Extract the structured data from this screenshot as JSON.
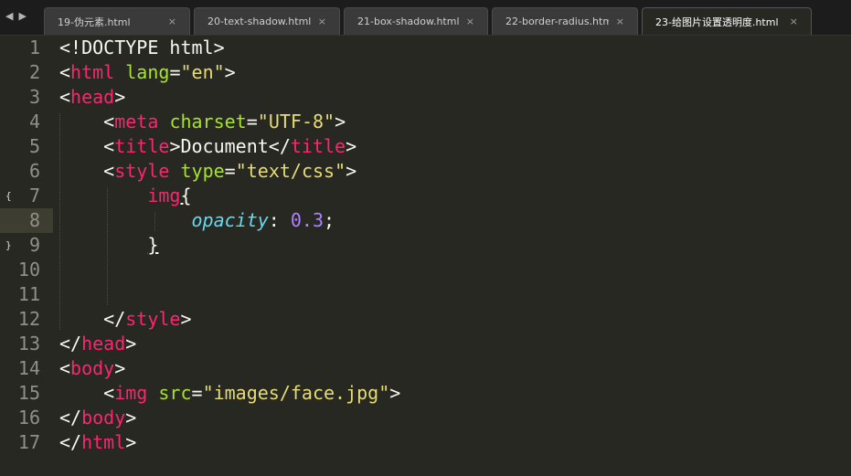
{
  "nav": {
    "back_icon": "left-triangle-icon",
    "forward_icon": "right-triangle-icon"
  },
  "tabs": [
    {
      "label": "19-伪元素.html",
      "close": "×"
    },
    {
      "label": "20-text-shadow.html",
      "close": "×"
    },
    {
      "label": "21-box-shadow.html",
      "close": "×"
    },
    {
      "label": "22-border-radius.html",
      "close": "×"
    },
    {
      "label": "23-给图片设置透明度.html",
      "close": "×"
    }
  ],
  "editor": {
    "current_line": 8,
    "fold_markers": {
      "7": "{",
      "9": "}"
    },
    "lines": [
      {
        "n": "1",
        "indent": "",
        "tokens": [
          [
            "plain",
            "<!DOCTYPE html>"
          ]
        ]
      },
      {
        "n": "2",
        "indent": "",
        "tokens": [
          [
            "plain",
            "<"
          ],
          [
            "tag",
            "html"
          ],
          [
            "plain",
            " "
          ],
          [
            "attr",
            "lang"
          ],
          [
            "plain",
            "="
          ],
          [
            "str",
            "\"en\""
          ],
          [
            "plain",
            ">"
          ]
        ]
      },
      {
        "n": "3",
        "indent": "",
        "tokens": [
          [
            "plain",
            "<"
          ],
          [
            "tag",
            "head"
          ],
          [
            "plain",
            ">"
          ]
        ]
      },
      {
        "n": "4",
        "indent": "    ",
        "tokens": [
          [
            "plain",
            "<"
          ],
          [
            "tag",
            "meta"
          ],
          [
            "plain",
            " "
          ],
          [
            "attr",
            "charset"
          ],
          [
            "plain",
            "="
          ],
          [
            "str",
            "\"UTF-8\""
          ],
          [
            "plain",
            ">"
          ]
        ]
      },
      {
        "n": "5",
        "indent": "    ",
        "tokens": [
          [
            "plain",
            "<"
          ],
          [
            "tag",
            "title"
          ],
          [
            "plain",
            ">Document</"
          ],
          [
            "tag",
            "title"
          ],
          [
            "plain",
            ">"
          ]
        ]
      },
      {
        "n": "6",
        "indent": "    ",
        "tokens": [
          [
            "plain",
            "<"
          ],
          [
            "tag",
            "style"
          ],
          [
            "plain",
            " "
          ],
          [
            "attr",
            "type"
          ],
          [
            "plain",
            "="
          ],
          [
            "str",
            "\"text/css\""
          ],
          [
            "plain",
            ">"
          ]
        ]
      },
      {
        "n": "7",
        "indent": "        ",
        "tokens": [
          [
            "tag",
            "img"
          ],
          [
            "plain-ul",
            "{"
          ]
        ]
      },
      {
        "n": "8",
        "indent": "            ",
        "tokens": [
          [
            "prop",
            "opacity"
          ],
          [
            "plain",
            ": "
          ],
          [
            "num",
            "0.3"
          ],
          [
            "plain",
            ";"
          ]
        ]
      },
      {
        "n": "9",
        "indent": "        ",
        "tokens": [
          [
            "plain-ul",
            "}"
          ]
        ]
      },
      {
        "n": "10",
        "indent": "",
        "tokens": []
      },
      {
        "n": "11",
        "indent": "",
        "tokens": []
      },
      {
        "n": "12",
        "indent": "    ",
        "tokens": [
          [
            "plain",
            "</"
          ],
          [
            "tag",
            "style"
          ],
          [
            "plain",
            ">"
          ]
        ]
      },
      {
        "n": "13",
        "indent": "",
        "tokens": [
          [
            "plain",
            "</"
          ],
          [
            "tag",
            "head"
          ],
          [
            "plain",
            ">"
          ]
        ]
      },
      {
        "n": "14",
        "indent": "",
        "tokens": [
          [
            "plain",
            "<"
          ],
          [
            "tag",
            "body"
          ],
          [
            "plain",
            ">"
          ]
        ]
      },
      {
        "n": "15",
        "indent": "    ",
        "tokens": [
          [
            "plain",
            "<"
          ],
          [
            "tag",
            "img"
          ],
          [
            "plain",
            " "
          ],
          [
            "attr",
            "src"
          ],
          [
            "plain",
            "="
          ],
          [
            "str",
            "\"images/face.jpg\""
          ],
          [
            "plain",
            ">"
          ]
        ]
      },
      {
        "n": "16",
        "indent": "",
        "tokens": [
          [
            "plain",
            "</"
          ],
          [
            "tag",
            "body"
          ],
          [
            "plain",
            ">"
          ]
        ]
      },
      {
        "n": "17",
        "indent": "",
        "tokens": [
          [
            "plain",
            "</"
          ],
          [
            "tag",
            "html"
          ],
          [
            "plain",
            ">"
          ]
        ]
      }
    ]
  }
}
